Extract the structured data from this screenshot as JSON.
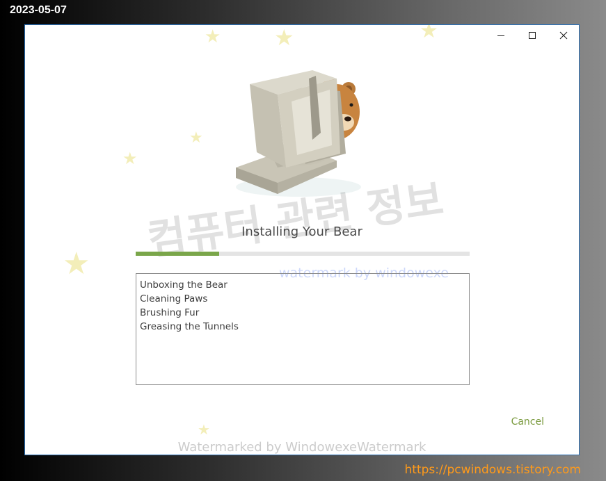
{
  "overlay": {
    "date": "2023-05-07",
    "url": "https://pcwindows.tistory.com"
  },
  "window_controls": {
    "minimize_icon": "minimize-icon",
    "maximize_icon": "maximize-icon",
    "close_icon": "close-icon"
  },
  "illustration": {
    "icon": "bear-in-computer-icon"
  },
  "installer": {
    "title": "Installing Your Bear",
    "progress_fraction": 0.25,
    "log_lines": [
      "Unboxing the Bear",
      "Cleaning Paws",
      "Brushing Fur",
      "Greasing the Tunnels"
    ],
    "cancel_label": "Cancel"
  },
  "watermarks": {
    "korean": "컴퓨터 관련 정보",
    "blue": "watermark by windowexe",
    "bottom": "Watermarked by WindowexeWatermark"
  },
  "colors": {
    "accent": "#7aa64a",
    "cancel": "#7a9a3e",
    "url": "#ff9a1a",
    "border": "#2a6fb5"
  }
}
